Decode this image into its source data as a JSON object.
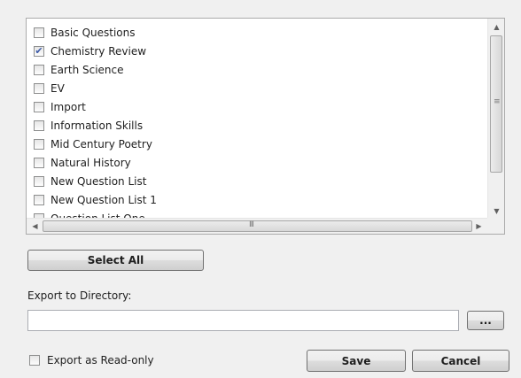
{
  "question_lists": [
    {
      "label": "Basic Questions",
      "checked": false
    },
    {
      "label": "Chemistry Review",
      "checked": true
    },
    {
      "label": "Earth Science",
      "checked": false
    },
    {
      "label": "EV",
      "checked": false
    },
    {
      "label": "Import",
      "checked": false
    },
    {
      "label": "Information Skills",
      "checked": false
    },
    {
      "label": "Mid Century Poetry",
      "checked": false
    },
    {
      "label": "Natural History",
      "checked": false
    },
    {
      "label": "New Question List",
      "checked": false
    },
    {
      "label": "New Question List 1",
      "checked": false
    },
    {
      "label": "Question List One",
      "checked": false
    }
  ],
  "check_glyph": "✔",
  "scrollbar": {
    "up_arrow": "▲",
    "down_arrow": "▼",
    "left_arrow": "◀",
    "right_arrow": "▶",
    "v_grip": "≡",
    "h_grip": "III"
  },
  "buttons": {
    "select_all": "Select All",
    "browse": "...",
    "save": "Save",
    "cancel": "Cancel"
  },
  "export": {
    "label": "Export to Directory:",
    "directory_value": "",
    "read_only_label": "Export as Read-only",
    "read_only_checked": false
  }
}
